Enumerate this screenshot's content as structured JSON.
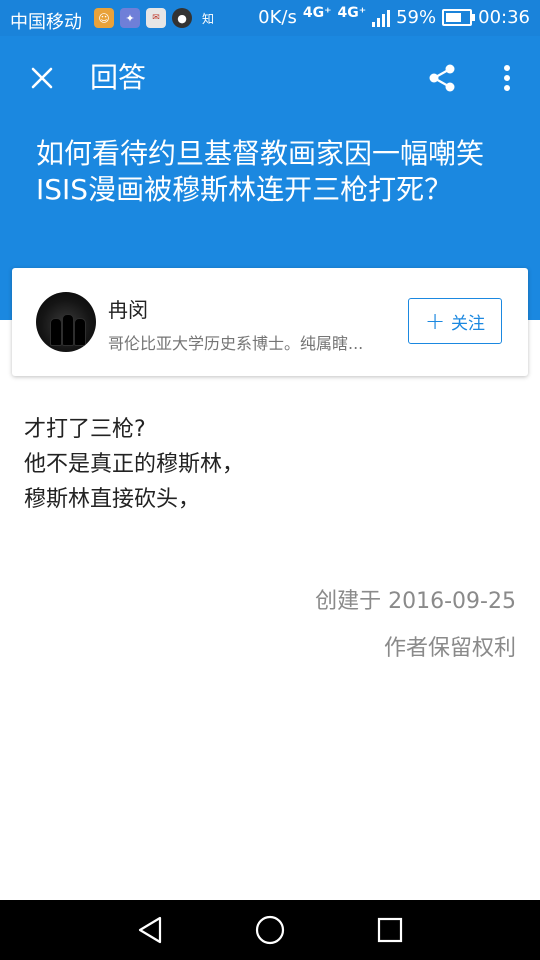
{
  "status_bar": {
    "carrier": "中国移动",
    "notification_icons": [
      "app-icon",
      "app-icon",
      "app-icon",
      "qq-icon",
      "zhihu-icon"
    ],
    "zhihu_glyph": "知",
    "net_speed": "0K/s",
    "net_type_1": "4G⁺",
    "net_type_2": "4G⁺",
    "battery_level": 0.59,
    "battery_text": "59%",
    "clock": "00:36"
  },
  "app_bar": {
    "title": "回答",
    "icons": [
      "close-icon",
      "share-icon",
      "more-vert-icon"
    ]
  },
  "question": {
    "title": "如何看待约旦基督教画家因一幅嘲笑ISIS漫画被穆斯林连开三枪打死？"
  },
  "author": {
    "name": "冉闵",
    "bio": "哥伦比亚大学历史系博士。纯属瞎...",
    "follow_label": "关注"
  },
  "answer": {
    "lines": [
      "才打了三枪?",
      "他不是真正的穆斯林，",
      "穆斯林直接砍头，"
    ],
    "created": "创建于 2016-09-25",
    "rights": "作者保留权利"
  },
  "nav_bar": {
    "icons": [
      "back-icon",
      "home-icon",
      "recents-icon"
    ]
  },
  "colors": {
    "primary": "#1b88e0",
    "status_bar": "#1a83da",
    "text": "#222222",
    "secondary_text": "#8a8a8a"
  }
}
